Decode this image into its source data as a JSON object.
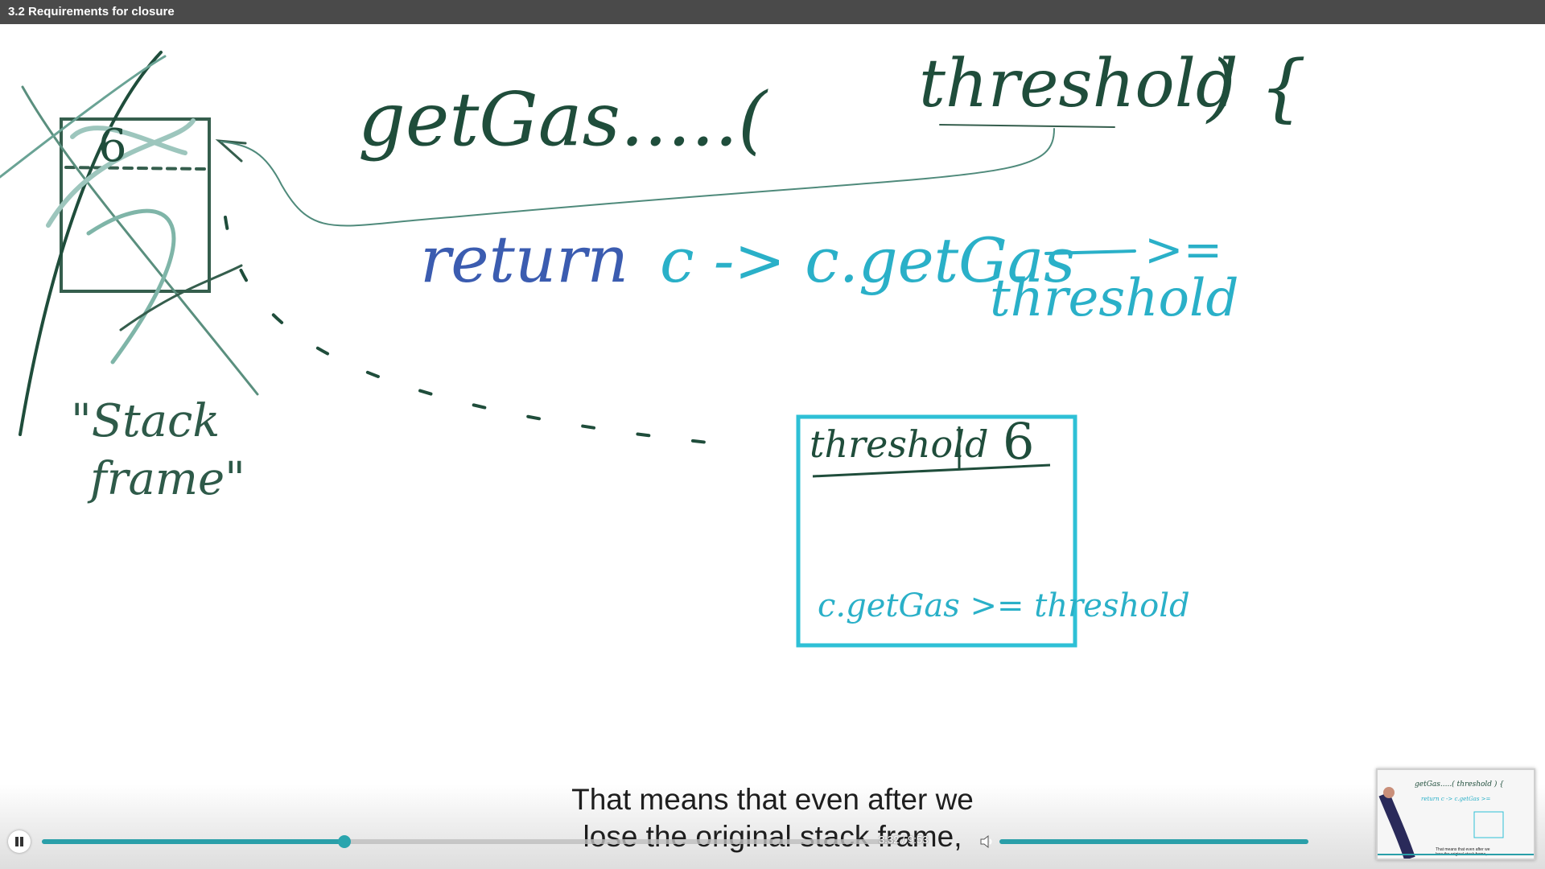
{
  "window": {
    "title": "3.2 Requirements for closure"
  },
  "whiteboard": {
    "colors": {
      "dark_ink": "#1f4d3b",
      "cyan_ink": "#2ab0c8",
      "blue_ink": "#3b5cb0",
      "box_ink": "#2ec0d6"
    },
    "stack_value": "6",
    "stack_label": "\"Stack frame\"",
    "signature": "getGas.....(",
    "param": "threshold",
    "brace": ") {",
    "return_kw": "return",
    "lambda": "c -> c.getGas",
    "lambda_op": ">=",
    "lambda_rhs": "threshold",
    "closure_var": "threshold",
    "closure_val": "6",
    "closure_body": "c.getGas >= threshold"
  },
  "caption": {
    "line1": "That means that even after we",
    "line2": "lose the original stack frame,"
  },
  "player": {
    "state": "playing",
    "progress": 0.355,
    "time_display": "3:32 / 9:53",
    "volume": 1.0,
    "accent": "#2a9fa9",
    "icons": [
      "pause-icon",
      "volume-icon"
    ],
    "preview": {
      "caption_line1": "That means that even after we",
      "caption_line2": "lose the original stack frame,"
    }
  }
}
